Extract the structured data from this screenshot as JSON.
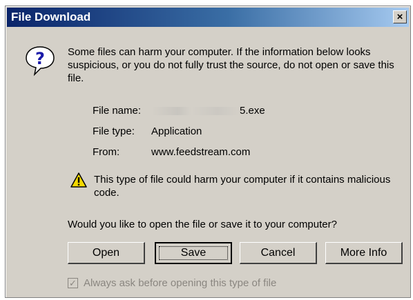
{
  "window": {
    "title": "File Download",
    "close_glyph": "×"
  },
  "intro_text": "Some files can harm your computer. If the information below looks suspicious, or you do not fully trust the source, do not open or save this file.",
  "file_info": {
    "name_label": "File name:",
    "name_value": "5.exe",
    "type_label": "File type:",
    "type_value": "Application",
    "from_label": "From:",
    "from_value": "www.feedstream.com"
  },
  "warning_text": "This type of file could harm your computer if it contains malicious code.",
  "question_text": "Would you like to open the file or save it to your computer?",
  "buttons": {
    "open": "Open",
    "save": "Save",
    "cancel": "Cancel",
    "more_info": "More Info"
  },
  "checkbox": {
    "label": "Always ask before opening this type of file",
    "checked": true,
    "check_glyph": "✓"
  },
  "icons": {
    "question": "question-icon",
    "warning": "warning-icon"
  },
  "colors": {
    "titlebar_start": "#0a246a",
    "titlebar_end": "#a6caf0",
    "dialog_face": "#d4d0c8",
    "disabled_text": "#8a8680"
  }
}
